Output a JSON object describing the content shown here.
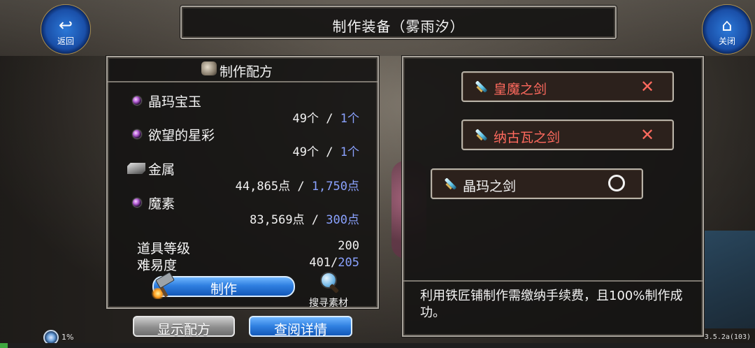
{
  "title": "制作装备（雾雨汐）",
  "buttons": {
    "back": "返回",
    "close": "关闭"
  },
  "recipe_panel": {
    "header": "制作配方",
    "materials": [
      {
        "name": "晶玛宝玉",
        "have": "49个",
        "sep": " / ",
        "need": "1个",
        "icon": "purple-orb-icon"
      },
      {
        "name": "欲望的星彩",
        "have": "49个",
        "sep": " / ",
        "need": "1个",
        "icon": "purple-orb-icon"
      },
      {
        "name": "金属",
        "have": "44,865点",
        "sep": " / ",
        "need": "1,750点",
        "icon": "metal-ingot-icon"
      },
      {
        "name": "魔素",
        "have": "83,569点",
        "sep": " / ",
        "need": "300点",
        "icon": "purple-orb-icon"
      }
    ],
    "item_level_label": "道具等级",
    "item_level_value": "200",
    "difficulty_label": "难易度",
    "difficulty_have": "401/",
    "difficulty_need": "205",
    "craft_label": "制作",
    "search_label": "搜寻素材"
  },
  "bottom": {
    "show_recipe": "显示配方",
    "view_details": "查阅详情"
  },
  "items": [
    {
      "name": "皇魔之剑",
      "status": "✕",
      "state": "unavailable",
      "color": "#ff6a5e"
    },
    {
      "name": "纳古瓦之剑",
      "status": "✕",
      "state": "unavailable",
      "color": "#ff6a5e"
    },
    {
      "name": "晶玛之剑",
      "status": "○",
      "state": "available",
      "color": "#f4f4f4"
    }
  ],
  "description": "利用铁匠铺制作需缴纳手续费，且100%制作成功。",
  "status": {
    "percent_text": "1%",
    "progress": 0.01,
    "version": "3.5.2a(103)"
  }
}
